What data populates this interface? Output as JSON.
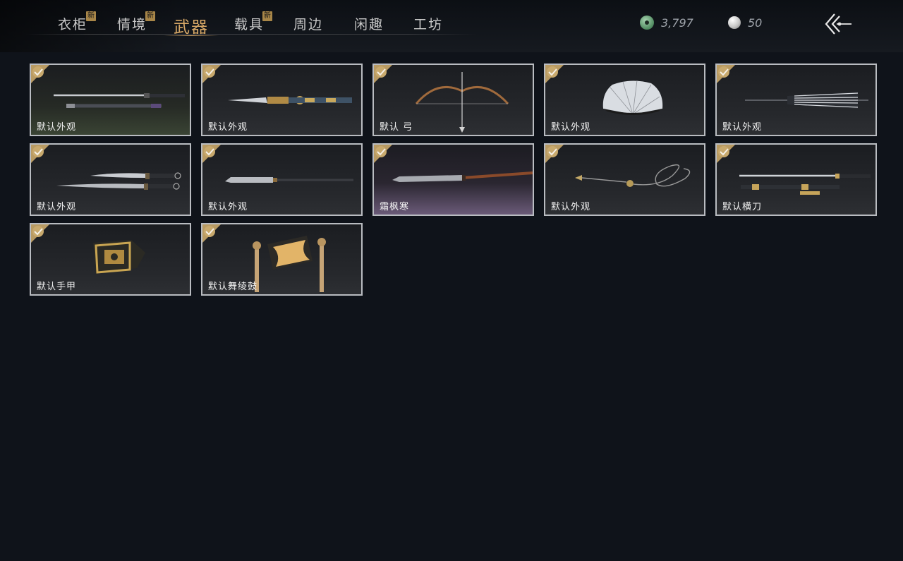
{
  "tabs": [
    {
      "label": "衣柜",
      "new": true,
      "active": false,
      "badge": "新"
    },
    {
      "label": "情境",
      "new": true,
      "active": false,
      "badge": "新"
    },
    {
      "label": "武器",
      "new": false,
      "active": true
    },
    {
      "label": "载具",
      "new": true,
      "active": false,
      "badge": "新"
    },
    {
      "label": "周边",
      "new": false,
      "active": false
    },
    {
      "label": "闲趣",
      "new": false,
      "active": false
    },
    {
      "label": "工坊",
      "new": false,
      "active": false
    }
  ],
  "currency": {
    "jade": {
      "value": "3,797",
      "icon": "jade-coin-icon"
    },
    "pearl": {
      "value": "50",
      "icon": "pearl-icon"
    }
  },
  "back": {
    "icon": "back-arrow-icon"
  },
  "items": [
    {
      "label": "默认外观",
      "art": "sword-pair",
      "selected": true
    },
    {
      "label": "默认外观",
      "art": "ornate-sword",
      "selected": true
    },
    {
      "label": "默认 弓",
      "art": "bow",
      "selected": true
    },
    {
      "label": "默认外观",
      "art": "fan",
      "selected": true
    },
    {
      "label": "默认外观",
      "art": "umbrella",
      "selected": true
    },
    {
      "label": "默认外观",
      "art": "twin-dao",
      "selected": true
    },
    {
      "label": "默认外观",
      "art": "glaive",
      "selected": true
    },
    {
      "label": "霜枫寒",
      "art": "spear",
      "selected": true
    },
    {
      "label": "默认外观",
      "art": "rope-dart",
      "selected": true
    },
    {
      "label": "默认横刀",
      "art": "hengdao",
      "selected": true
    },
    {
      "label": "默认手甲",
      "art": "gauntlet",
      "selected": true
    },
    {
      "label": "默认舞绫鼓",
      "art": "drum",
      "selected": true
    }
  ],
  "colors": {
    "accent_gold": "#d7a867",
    "card_border": "#b9bcc1",
    "background": "#0f131a",
    "check_badge": "#b89a62"
  }
}
